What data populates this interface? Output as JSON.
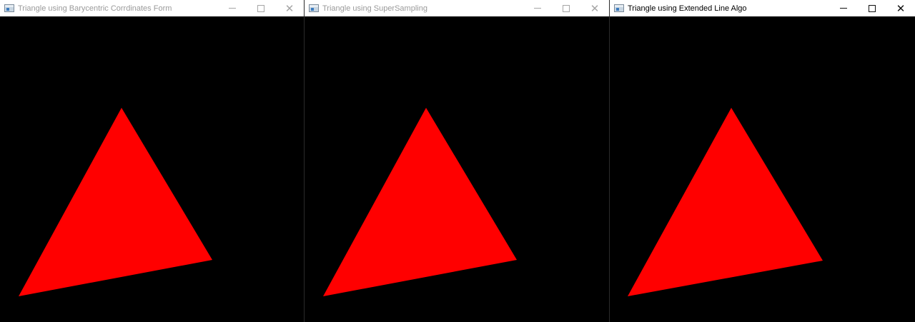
{
  "windows": [
    {
      "title": "Triangle using Barycentric Corrdinates Form",
      "state": "inactive",
      "icon": "app-window-icon",
      "controls": {
        "minimize": "minimize-icon",
        "maximize": "maximize-icon",
        "close": "close-icon"
      }
    },
    {
      "title": "Triangle using SuperSampling",
      "state": "inactive",
      "icon": "app-window-icon",
      "controls": {
        "minimize": "minimize-icon",
        "maximize": "maximize-icon",
        "close": "close-icon"
      }
    },
    {
      "title": "Triangle using Extended Line Algo",
      "state": "active",
      "icon": "app-window-icon",
      "controls": {
        "minimize": "minimize-icon",
        "maximize": "maximize-icon",
        "close": "close-icon"
      }
    }
  ],
  "colors": {
    "canvas_bg": "#000000",
    "triangle_fill": "#ff0000",
    "titlebar_bg": "#ffffff"
  }
}
